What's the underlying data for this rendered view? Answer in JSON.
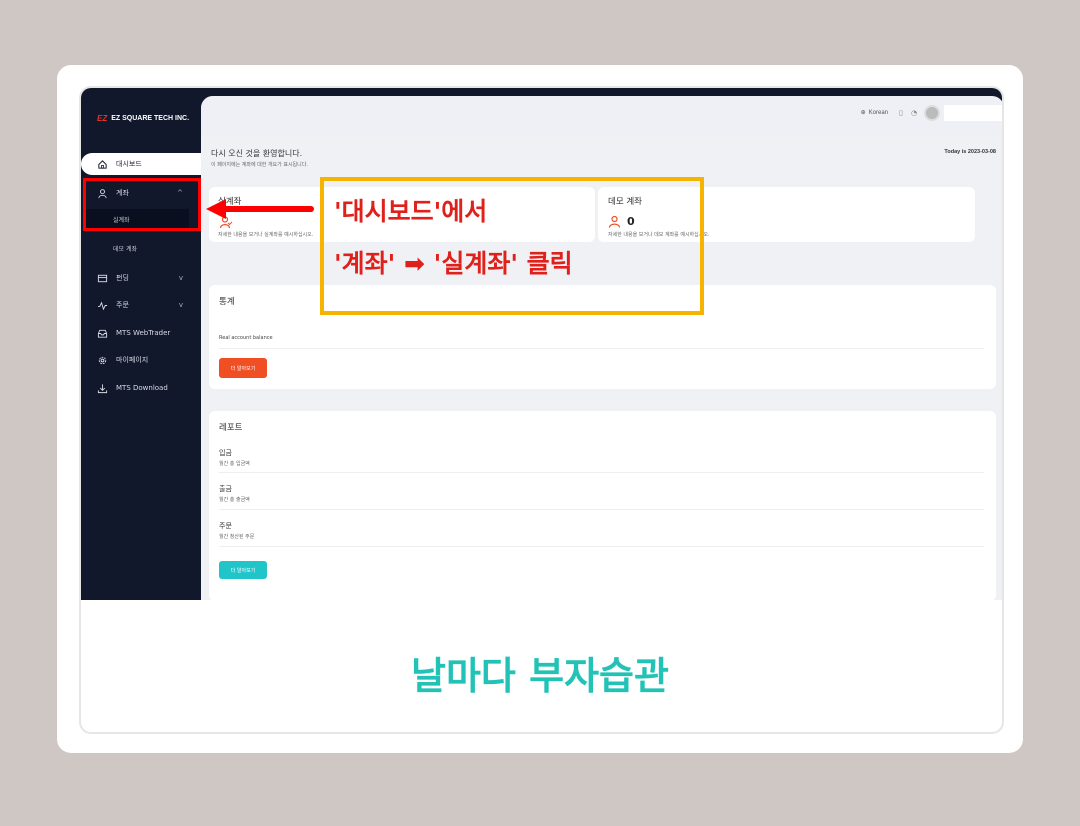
{
  "app": {
    "logo_mark": "EZ",
    "logo_text": "EZ SQUARE TECH INC.",
    "topbar": {
      "language": "Korean"
    },
    "welcome": "다시 오신 것을 환영합니다.",
    "welcome_sub": "이 페이지에는 계좌에 대한 개요가 표시됩니다.",
    "today": "Today is 2023-03-08"
  },
  "sidebar": {
    "items": [
      {
        "label": "대시보드",
        "icon": "home-icon"
      },
      {
        "label": "계좌",
        "icon": "user-icon",
        "chevron": "^"
      },
      {
        "label": "펀딩",
        "icon": "card-icon",
        "chevron": "v"
      },
      {
        "label": "주문",
        "icon": "pulse-icon",
        "chevron": "v"
      },
      {
        "label": "MTS WebTrader",
        "icon": "inbox-icon"
      },
      {
        "label": "마이페이지",
        "icon": "gear-icon"
      },
      {
        "label": "MTS Download",
        "icon": "download-icon"
      }
    ],
    "sub_items": [
      "실계좌",
      "데모 계좌"
    ]
  },
  "cards": {
    "real": {
      "title": "실계좌",
      "desc": "자세한 내용을 보거나 실계좌를 예시하십시오."
    },
    "demo": {
      "title": "데모 계좌",
      "count": "0",
      "desc": "자세한 내용을 보거나 데모 계좌를 예시하십시오."
    }
  },
  "stats": {
    "title": "통계",
    "row": "Real account balance",
    "button": "더 알아보기"
  },
  "report": {
    "title": "레포트",
    "rows": [
      {
        "label": "입금",
        "sub": "월간 총 입금액"
      },
      {
        "label": "출금",
        "sub": "월간 총 출금액"
      },
      {
        "label": "주문",
        "sub": "월간 청산된 주문"
      }
    ],
    "button": "더 알아보기"
  },
  "annotation": {
    "line1": "'대시보드'에서",
    "line2": "'계좌' ➡ '실계좌' 클릭",
    "box_color": "#f6b400",
    "highlight_color": "#ff0000"
  },
  "caption": "날마다 부자습관",
  "colors": {
    "sidebar": "#12182c",
    "accent_red": "#f04e23",
    "accent_teal": "#20c5c9",
    "caption": "#22c3b6"
  }
}
